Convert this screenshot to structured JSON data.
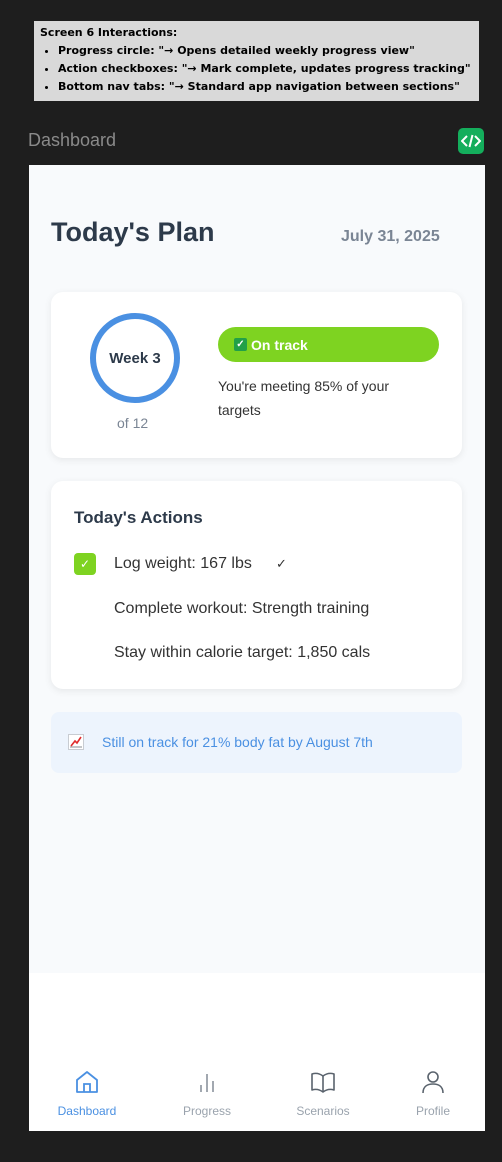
{
  "note": {
    "title": "Screen 6 Interactions:",
    "items": [
      "Progress circle: \"→ Opens detailed weekly progress view\"",
      "Action checkboxes: \"→ Mark complete, updates progress tracking\"",
      "Bottom nav tabs: \"→ Standard app navigation between sections\""
    ]
  },
  "frame": {
    "label": "Dashboard",
    "code_icon": "code-icon"
  },
  "header": {
    "title": "Today's Plan",
    "date": "July 31, 2025"
  },
  "progress": {
    "week_label": "Week 3",
    "of_label": "of 12",
    "status_badge": "On track",
    "status_icon": "check-box-icon",
    "summary": "You're meeting 85% of your targets",
    "ring_color": "#4a90e2",
    "badge_color": "#7ed321"
  },
  "actions": {
    "title": "Today's Actions",
    "items": [
      {
        "label": "Log weight: 167 lbs",
        "completed": true,
        "check": "✓"
      },
      {
        "label": "Complete workout: Strength training",
        "completed": false
      },
      {
        "label": "Stay within calorie target: 1,850 cals",
        "completed": false
      }
    ]
  },
  "banner": {
    "icon": "chart-increasing-icon",
    "text": "Still on track for 21% body fat by August 7th"
  },
  "nav": {
    "active": "Dashboard",
    "tabs": [
      {
        "label": "Dashboard",
        "icon": "home-icon"
      },
      {
        "label": "Progress",
        "icon": "bar-chart-icon"
      },
      {
        "label": "Scenarios",
        "icon": "book-icon"
      },
      {
        "label": "Profile",
        "icon": "user-icon"
      }
    ]
  },
  "colors": {
    "accent": "#4a90e2",
    "success": "#7ed321",
    "text": "#2d3a4a"
  }
}
